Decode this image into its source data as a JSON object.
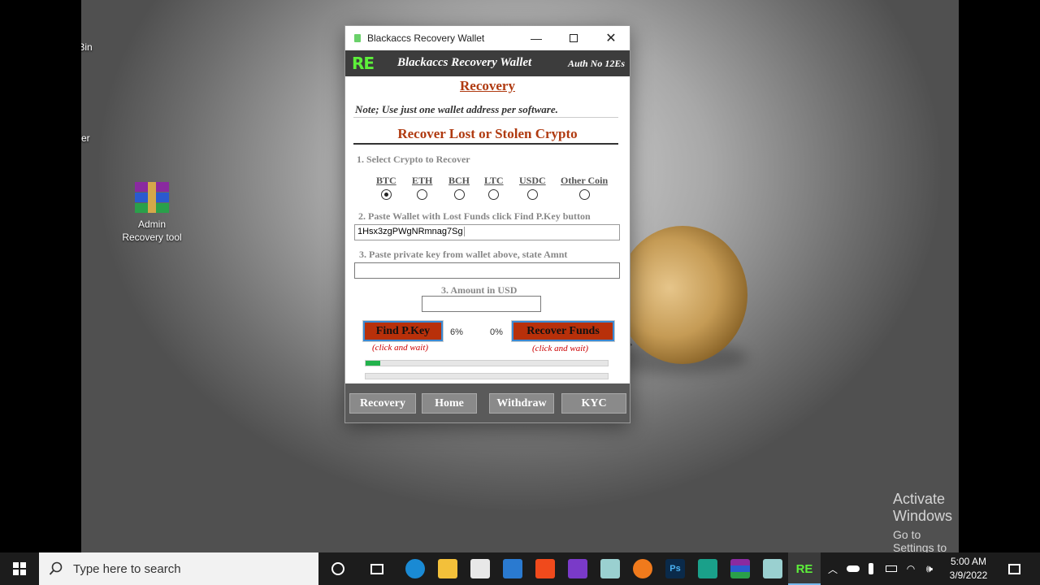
{
  "desktop": {
    "icons": [
      {
        "label": "Recycle Bin"
      },
      {
        "label": "New folder"
      },
      {
        "label_line1": "Admin",
        "label_line2": "Recovery tool"
      }
    ],
    "watermark": {
      "line1": "Activate Windows",
      "line2": "Go to Settings to activate Windows."
    }
  },
  "window": {
    "title": "Blackaccs Recovery Wallet",
    "header": {
      "logo": "RE",
      "title": "Blackaccs Recovery Wallet",
      "auth": "Auth No 12Es"
    },
    "section_title": "Recovery",
    "note": "Note; Use just one wallet address per software.",
    "heading": "Recover Lost or Stolen Crypto",
    "step1": "1.  Select Crypto to Recover",
    "coins": [
      {
        "label": "BTC",
        "selected": true
      },
      {
        "label": "ETH",
        "selected": false
      },
      {
        "label": "BCH",
        "selected": false
      },
      {
        "label": "LTC",
        "selected": false
      },
      {
        "label": "USDC",
        "selected": false
      },
      {
        "label": "Other Coin",
        "selected": false
      }
    ],
    "step2": "2. Paste Wallet with Lost Funds  click Find P.Key button",
    "wallet_value": "1Hsx3zgPWgNRmnag7Sg",
    "step3": "3. Paste private key from wallet above, state Amnt",
    "private_key_value": "",
    "amount_label": "3. Amount in USD",
    "amount_value": "",
    "find_button": "Find P.Key",
    "find_hint": "(click and wait)",
    "find_percent": "6%",
    "recover_percent": "0%",
    "recover_button": "Recover Funds",
    "recover_hint": "(click and wait)",
    "progress_find": 0.06,
    "progress_recover": 0.0,
    "nav": [
      "Recovery",
      "Home",
      "Withdraw",
      "KYC"
    ]
  },
  "taskbar": {
    "search_placeholder": "Type here to search",
    "time": "5:00 AM",
    "date": "3/9/2022"
  },
  "colors": {
    "accent": "#b8300a",
    "heading": "#b03a10",
    "logo": "#5df03a",
    "progress": "#22b24c"
  }
}
